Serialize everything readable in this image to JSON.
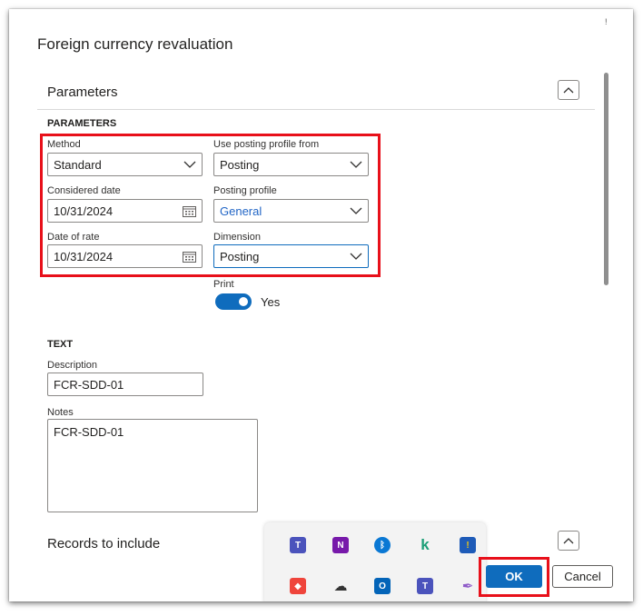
{
  "dialog": {
    "title": "Foreign currency revaluation",
    "corner_mark": "!"
  },
  "parameters_section": {
    "title": "Parameters",
    "group_title": "PARAMETERS",
    "method": {
      "label": "Method",
      "value": "Standard"
    },
    "use_posting_profile_from": {
      "label": "Use posting profile from",
      "value": "Posting"
    },
    "considered_date": {
      "label": "Considered date",
      "value": "10/31/2024"
    },
    "posting_profile": {
      "label": "Posting profile",
      "value": "General"
    },
    "date_of_rate": {
      "label": "Date of rate",
      "value": "10/31/2024"
    },
    "dimension": {
      "label": "Dimension",
      "value": "Posting"
    },
    "print": {
      "label": "Print",
      "value": "Yes",
      "enabled": true
    }
  },
  "text_section": {
    "group_title": "TEXT",
    "description": {
      "label": "Description",
      "value": "FCR-SDD-01"
    },
    "notes": {
      "label": "Notes",
      "value": "FCR-SDD-01"
    }
  },
  "records_section": {
    "title": "Records to include"
  },
  "footer": {
    "ok_label": "OK",
    "cancel_label": "Cancel"
  },
  "tray_icons": [
    "teams-icon",
    "onenote-icon",
    "bluetooth-icon",
    "kaizala-icon",
    "defender-icon",
    "anydesk-icon",
    "cloud-sync-icon",
    "outlook-icon",
    "teams-status-icon",
    "pen-icon"
  ],
  "colors": {
    "accent": "#0f6cbd",
    "highlight": "#e8101a",
    "link": "#2266c6"
  }
}
